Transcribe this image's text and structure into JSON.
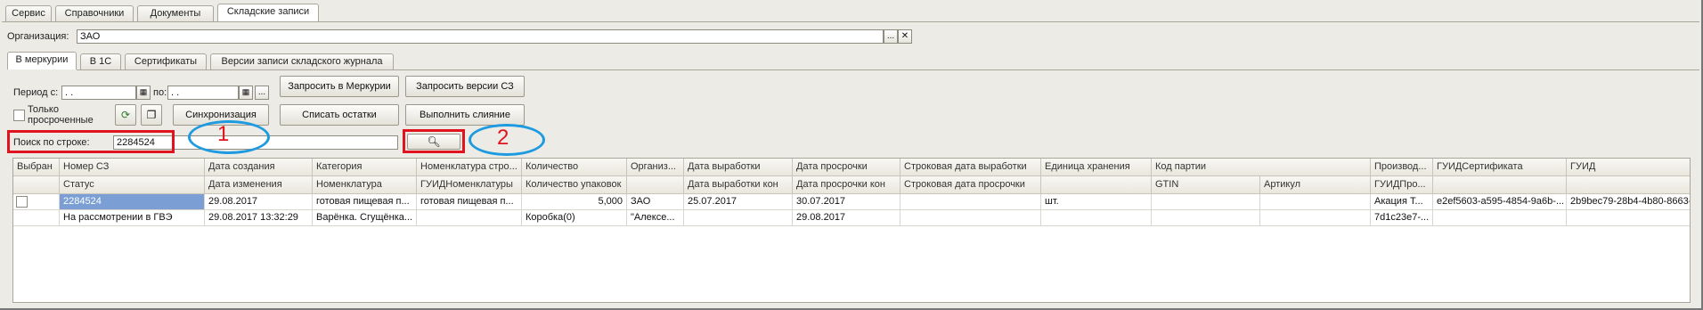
{
  "top_tabs": [
    "Сервис",
    "Справочники",
    "Документы",
    "Складские записи"
  ],
  "organization": {
    "label": "Организация:",
    "value": "ЗАО",
    "more": "...",
    "clear": "✕"
  },
  "sub_tabs": [
    "В меркурии",
    "В 1С",
    "Сертификаты",
    "Версии записи складского журнала"
  ],
  "period": {
    "from_label": "Период с:",
    "from_value": " .  .",
    "to_label": "по:",
    "to_value": " .  .",
    "more": "..."
  },
  "only": {
    "label_line1": "Только",
    "label_line2": "просроченные"
  },
  "buttons": {
    "request_mercury": "Запросить в Меркурии",
    "request_versions": "Запросить версии СЗ",
    "sync": "Синхронизация",
    "write_off": "Списать остатки",
    "merge": "Выполнить слияние"
  },
  "search": {
    "label": "Поиск по строке:",
    "value": "2284524",
    "button_icon": "magnifier-icon"
  },
  "annotations": {
    "one": "1",
    "two": "2"
  },
  "table": {
    "header_row1": [
      "Выбран",
      "Номер СЗ",
      "Дата создания",
      "Категория",
      "Номенклатура стро...",
      "Количество",
      "Организ...",
      "Дата выработки",
      "Дата просрочки",
      "Строковая дата выработки",
      "Единица хранения",
      "Код партии",
      "",
      "Производ...",
      "ГУИДСертификата",
      "ГУИД"
    ],
    "header_row2": [
      "",
      "Статус",
      "Дата изменения",
      "Номенклатура",
      "ГУИДНоменклатуры",
      "Количество упаковок",
      "",
      "Дата выработки кон",
      "Дата просрочки кон",
      "Строковая дата просрочки",
      "",
      "GTIN",
      "Артикул",
      "ГУИДПро...",
      "",
      ""
    ],
    "row1": [
      "",
      "2284524",
      "29.08.2017",
      "готовая пищевая п...",
      "готовая пищевая п...",
      "5,000",
      "ЗАО",
      "25.07.2017",
      "30.07.2017",
      "",
      "шт.",
      "",
      "",
      "Акация Т...",
      "e2ef5603-a595-4854-9a6b-...",
      "2b9bec79-28b4-4b80-8663-..."
    ],
    "row2": [
      "",
      "На рассмотрении в ГВЭ",
      "29.08.2017 13:32:29",
      "Варёнка. Сгущёнка...",
      "",
      "Коробка(0)",
      "\"Алексе...",
      "",
      "29.08.2017",
      "",
      "",
      "",
      "",
      "7d1c23e7-...",
      "",
      ""
    ]
  }
}
